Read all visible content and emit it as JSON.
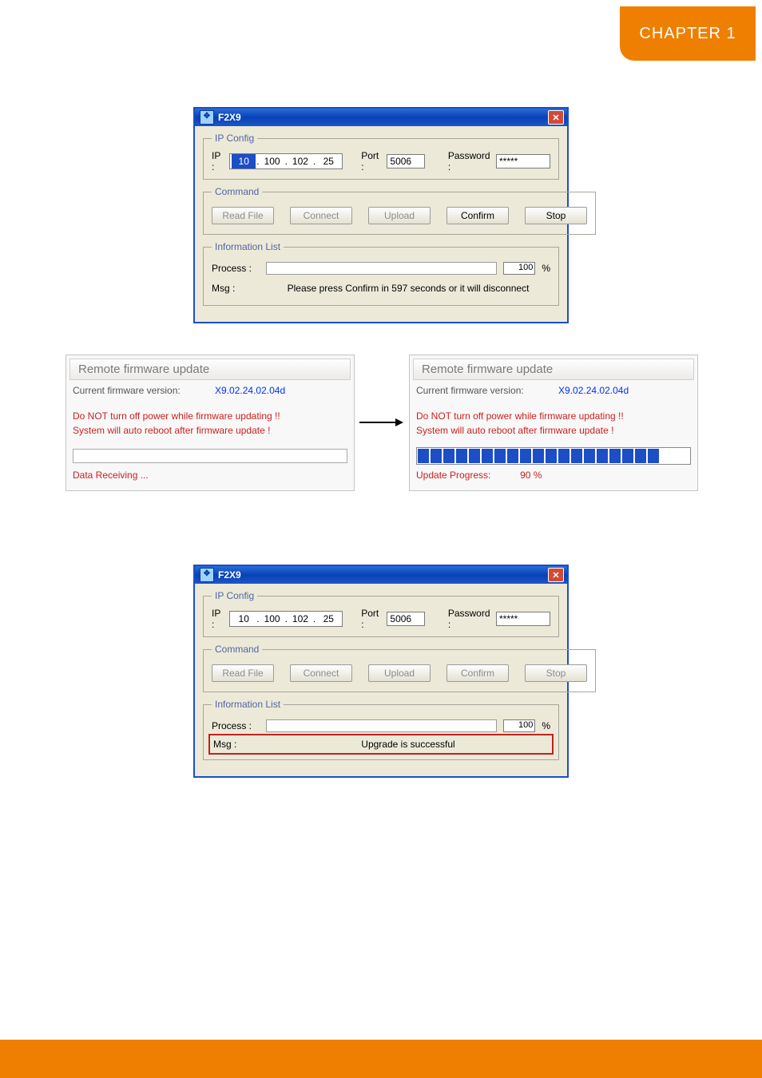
{
  "chapter_tab": "CHAPTER 1",
  "win": {
    "title": "F2X9",
    "ip_config": {
      "legend": "IP Config",
      "ip_label": "IP :",
      "port_label": "Port :",
      "password_label": "Password :",
      "port": "5006",
      "password": "*****",
      "oct1": "10",
      "oct2": "100",
      "oct3": "102",
      "oct4": "25"
    },
    "command": {
      "legend": "Command",
      "read_file": "Read File",
      "connect": "Connect",
      "upload": "Upload",
      "confirm": "Confirm",
      "stop": "Stop"
    },
    "info": {
      "legend": "Information List",
      "process_label": "Process :",
      "msg_label": "Msg :",
      "percent_unit": "%"
    }
  },
  "win_top": {
    "process_value": "100",
    "msg": "Please press Confirm in 597 seconds or it will disconnect"
  },
  "win_bottom": {
    "process_value": "100",
    "msg": "Upgrade is successful"
  },
  "rfu": {
    "title": "Remote firmware update",
    "current_label": "Current firmware version:",
    "version": "X9.02.24.02.04d",
    "warn1": "Do NOT turn off power while firmware updating !!",
    "warn2": "System will auto reboot after firmware update !"
  },
  "rfu_left": {
    "bottom_text": "Data Receiving ..."
  },
  "rfu_right": {
    "progress_label": "Update Progress:",
    "progress_value": "90 %"
  }
}
